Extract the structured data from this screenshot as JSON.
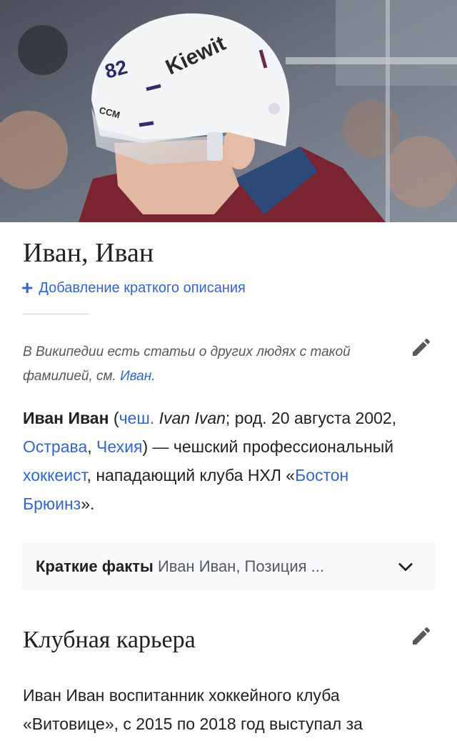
{
  "hero": {
    "helmet_number": "82",
    "helmet_brand": "Kiewit",
    "helmet_maker": "CCM"
  },
  "article": {
    "title": "Иван, Иван",
    "add_description": "Добавление краткого описания",
    "hatnote": {
      "text": "В Википедии есть статьи о других людях с такой фамилией, см. ",
      "link": "Иван",
      "end": "."
    },
    "lead": {
      "name_bold": "Иван Иван",
      "open_paren": " (",
      "lang_link": "чеш.",
      "native_name": "Ivan Ivan",
      "born": "; род. 20 августа 2002, ",
      "city_link": "Острава",
      "comma": ", ",
      "country_link": "Чехия",
      "desc1": ") — чешский профессиональный ",
      "hockey_link": "хоккеист",
      "desc2": ", нападающий клуба НХЛ «",
      "club_link": "Бостон Брюинз",
      "desc3": "»."
    },
    "facts": {
      "label": "Краткие факты",
      "summary": " Иван Иван, Позиция ..."
    },
    "section": {
      "heading": "Клубная карьера",
      "paragraph": "Иван Иван воспитанник хоккейного клуба «Витовице», с 2015 по 2018 год выступал за"
    }
  },
  "icons": {
    "edit": "pencil-icon",
    "expand": "chevron-down-icon",
    "add": "plus-icon"
  },
  "colors": {
    "link": "#3366cc",
    "text": "#202122",
    "muted": "#54595d",
    "jersey": "#7a2432"
  }
}
